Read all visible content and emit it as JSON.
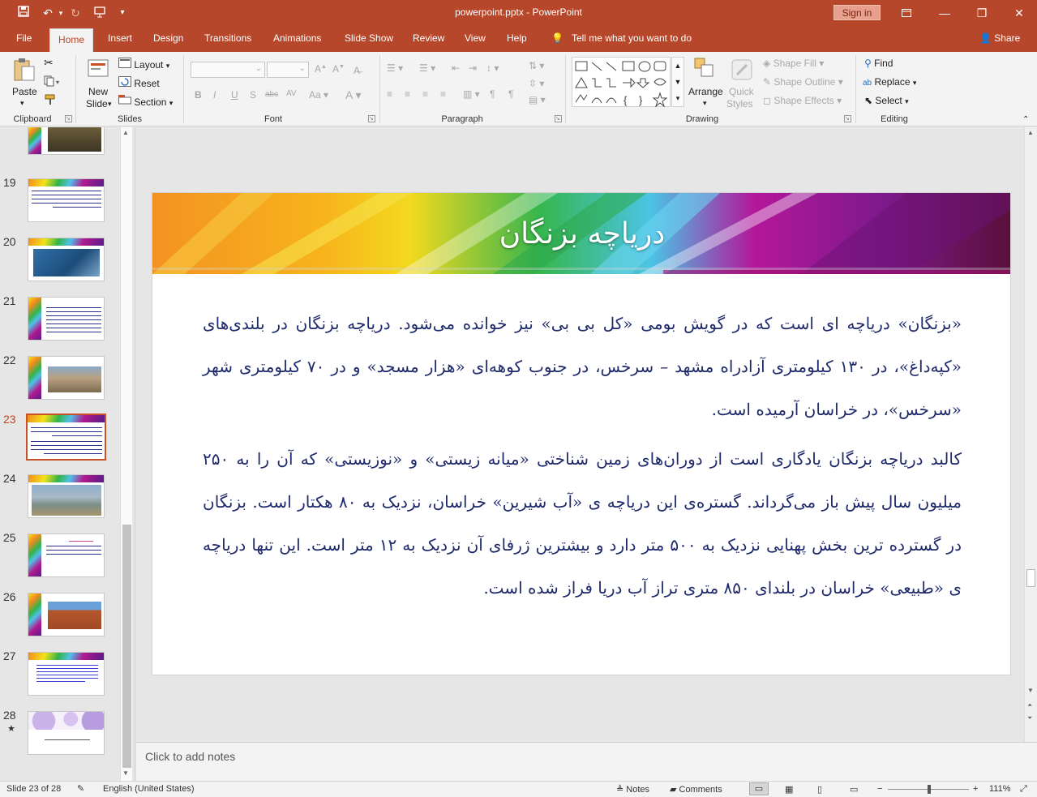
{
  "app": {
    "doc_title": "powerpoint.pptx - PowerPoint",
    "signin": "Sign in"
  },
  "tabs": [
    "File",
    "Home",
    "Insert",
    "Design",
    "Transitions",
    "Animations",
    "Slide Show",
    "Review",
    "View",
    "Help"
  ],
  "active_tab": "Home",
  "tellme": "Tell me what you want to do",
  "share": "Share",
  "ribbon": {
    "clipboard": {
      "label": "Clipboard",
      "paste": "Paste"
    },
    "slides": {
      "label": "Slides",
      "new_slide_1": "New",
      "new_slide_2": "Slide",
      "layout": "Layout",
      "reset": "Reset",
      "section": "Section"
    },
    "font": {
      "label": "Font"
    },
    "paragraph": {
      "label": "Paragraph"
    },
    "drawing": {
      "label": "Drawing",
      "arrange": "Arrange",
      "quick_styles_1": "Quick",
      "quick_styles_2": "Styles",
      "shape_fill": "Shape Fill",
      "shape_outline": "Shape Outline",
      "shape_effects": "Shape Effects"
    },
    "editing": {
      "label": "Editing",
      "find": "Find",
      "replace": "Replace",
      "select": "Select"
    }
  },
  "thumbnails": [
    {
      "num": "19"
    },
    {
      "num": "20"
    },
    {
      "num": "21"
    },
    {
      "num": "22"
    },
    {
      "num": "23"
    },
    {
      "num": "24"
    },
    {
      "num": "25"
    },
    {
      "num": "26"
    },
    {
      "num": "27"
    },
    {
      "num": "28"
    }
  ],
  "selected_slide": "23",
  "slide": {
    "title": "دریاچه بزنگان",
    "para1": "«بزنگان» دریاچه ای است که در گویش بومی «کل بی بی» نیز خوانده می‌شود. دریاچه بزنگان در بلندی‌های «کپه‌داغ»، در ۱۳۰ کیلومتری آزادراه مشهد – سرخس، در جنوب کوهه‌ای «هزار مسجد» و در ۷۰ کیلومتری شهر «سرخس»، در خراسان آرمیده است.",
    "para2": "کالبد دریاچه بزنگان یادگاری است از دوران‌های زمین شناختی «میانه زیستی» و «نوزیستی» که آن را به ۲۵۰ میلیون سال پیش باز می‌گرداند. گستره‌ی این دریاچه ی «آب شیرین» خراسان، نزدیک به ۸۰ هکتار است. بزنگان در گسترده ترین بخش پهنایی نزدیک به ۵۰۰ متر دارد و بیشترین ژرفای آن نزدیک به ۱۲ متر است. این تنها دریاچه ی «طبیعی» خراسان در بلندای ۸۵۰ متری تراز آب دریا فراز شده است."
  },
  "notes_placeholder": "Click to add notes",
  "status": {
    "slide_info": "Slide 23 of 28",
    "language": "English (United States)",
    "notes": "Notes",
    "comments": "Comments",
    "zoom": "111%"
  },
  "colors": {
    "accent": "#b7472a",
    "body_text": "#1f2a6c"
  }
}
